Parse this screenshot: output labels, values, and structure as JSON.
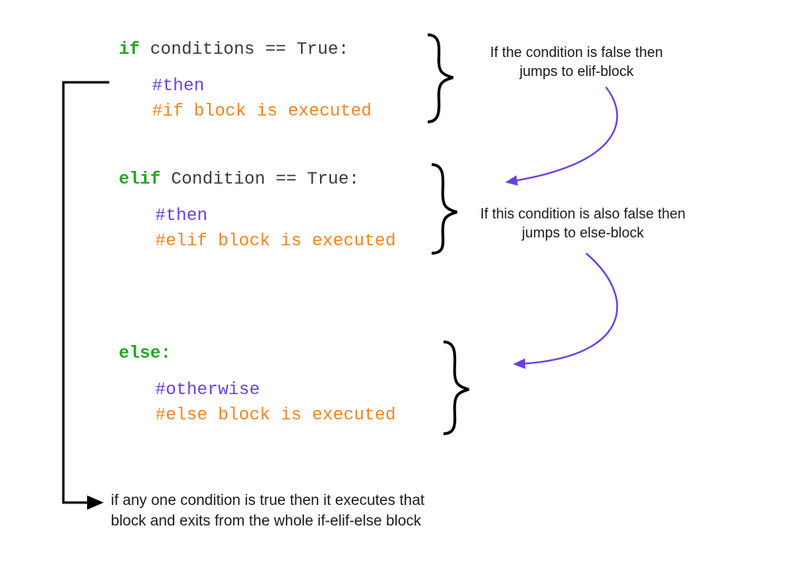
{
  "code": {
    "if_kw": "if",
    "if_cond": " conditions == True:",
    "if_then": "#then",
    "if_body": "#if block is executed",
    "elif_kw": "elif",
    "elif_cond": " Condition == True:",
    "elif_then": "#then",
    "elif_body": "#elif block is executed",
    "else_kw": "else:",
    "else_then": "#otherwise",
    "else_body": "#else block is executed"
  },
  "annotations": {
    "if_note_l1": "If the condition is false then",
    "if_note_l2": "jumps to elif-block",
    "elif_note_l1": "If this condition is also false then",
    "elif_note_l2": "jumps to else-block",
    "exit_note_l1": "if any one condition is true then it executes that",
    "exit_note_l2": "block and exits from the whole if-elif-else block"
  }
}
